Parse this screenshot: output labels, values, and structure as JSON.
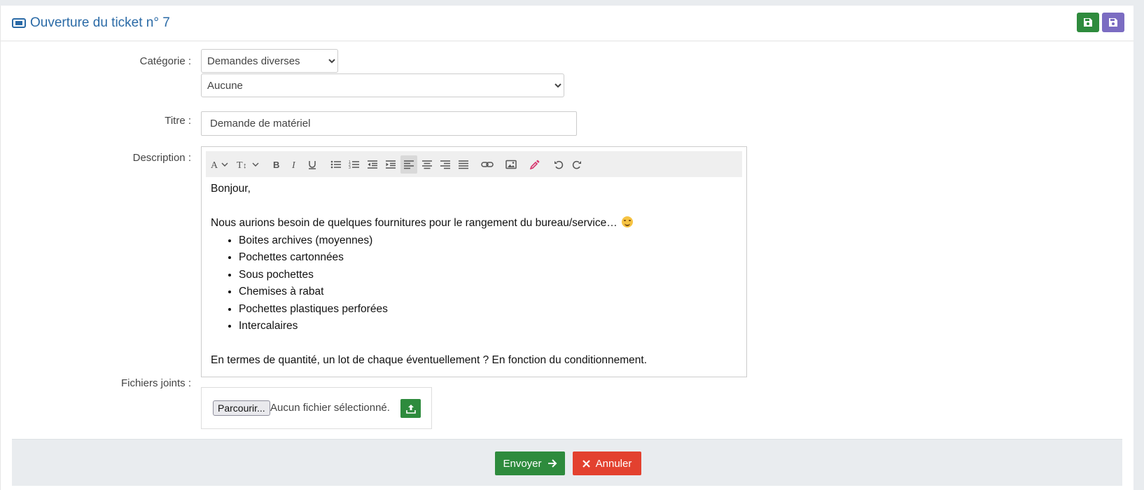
{
  "header": {
    "title": "Ouverture du ticket n° 7",
    "icons": [
      "ticket-icon",
      "save-icon",
      "save-icon"
    ]
  },
  "form": {
    "category_label": "Catégorie :",
    "category_value": "Demandes diverses",
    "subcategory_value": "Aucune",
    "title_label": "Titre :",
    "title_value": "Demande de matériel",
    "description_label": "Description :",
    "description": {
      "greeting": "Bonjour,",
      "intro": "Nous aurions besoin de quelques fournitures pour le rangement du bureau/service…",
      "items": [
        "Boites archives (moyennes)",
        "Pochettes cartonnées",
        "Sous pochettes",
        "Chemises à rabat",
        "Pochettes plastiques perforées",
        "Intercalaires"
      ],
      "closing": "En termes de quantité, un lot de chaque éventuellement ? En fonction du conditionnement."
    },
    "files_label": "Fichiers joints :",
    "browse_label": "Parcourir...",
    "no_file": "Aucun fichier sélectionné."
  },
  "footer": {
    "send_label": "Envoyer",
    "cancel_label": "Annuler"
  },
  "colors": {
    "title": "#2a6aa6",
    "green": "#2e8b3d",
    "purple": "#7b6cc2",
    "red": "#e3412f"
  }
}
